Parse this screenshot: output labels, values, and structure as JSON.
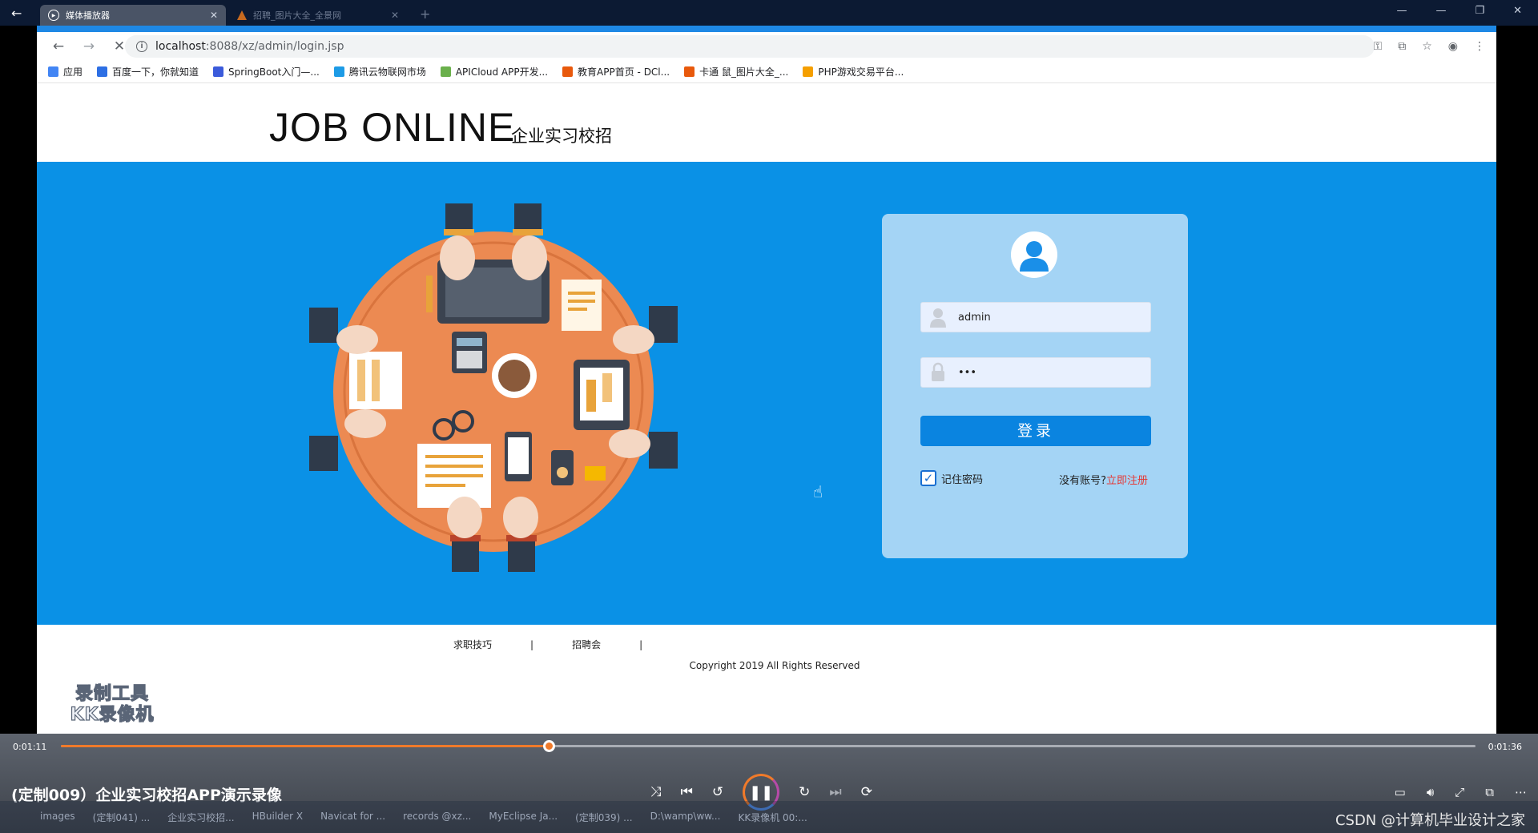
{
  "player": {
    "tab_title": "媒体播放器",
    "tab2_title": "招聘_图片大全_全景网",
    "time_current": "0:01:11",
    "time_total": "0:01:36",
    "progress": 0.345,
    "video_title": "(定制009）企业实习校招APP演示录像"
  },
  "browser": {
    "url_host": "localhost",
    "url_path": ":8088/xz/admin/login.jsp",
    "bookmarks": [
      {
        "label": "应用",
        "color": "#4285f4"
      },
      {
        "label": "百度一下，你就知道",
        "color": "#2d6fe4"
      },
      {
        "label": "SpringBoot入门—...",
        "color": "#3b5bdb"
      },
      {
        "label": "腾讯云物联网市场",
        "color": "#1d9be6"
      },
      {
        "label": "APICloud APP开发...",
        "color": "#6ab04c"
      },
      {
        "label": "教育APP首页 - DCl...",
        "color": "#e8590c"
      },
      {
        "label": "卡通 鼠_图片大全_...",
        "color": "#e8590c"
      },
      {
        "label": "PHP游戏交易平台...",
        "color": "#f59f00"
      }
    ]
  },
  "site": {
    "logo_main": "JOB ONLINE",
    "logo_sub": "企业实习校招",
    "colors": {
      "hero": "#0a91e6",
      "card": "#a4d4f5",
      "button": "#0a84e0",
      "table": "#ec8a52"
    }
  },
  "login": {
    "username_value": "admin",
    "password_value": "•••",
    "login_label": "登录",
    "remember_label": "记住密码",
    "remember_checked": true,
    "no_account_text": "没有账号?",
    "register_link": "立即注册"
  },
  "footer": {
    "links": [
      "求职技巧",
      "招聘会"
    ],
    "copyright": "Copyright 2019 All Rights Reserved"
  },
  "watermark": {
    "line1": "录制工具",
    "line2": "KK录像机"
  },
  "taskbar": {
    "items": [
      "images",
      "(定制041) ...",
      "企业实习校招...",
      "HBuilder X",
      "Navicat for ...",
      "records @xz...",
      "MyEclipse Ja...",
      "(定制039) ...",
      "D:\\wamp\\ww...",
      "KK录像机 00:..."
    ],
    "csdn": "CSDN @计算机毕业设计之家"
  }
}
